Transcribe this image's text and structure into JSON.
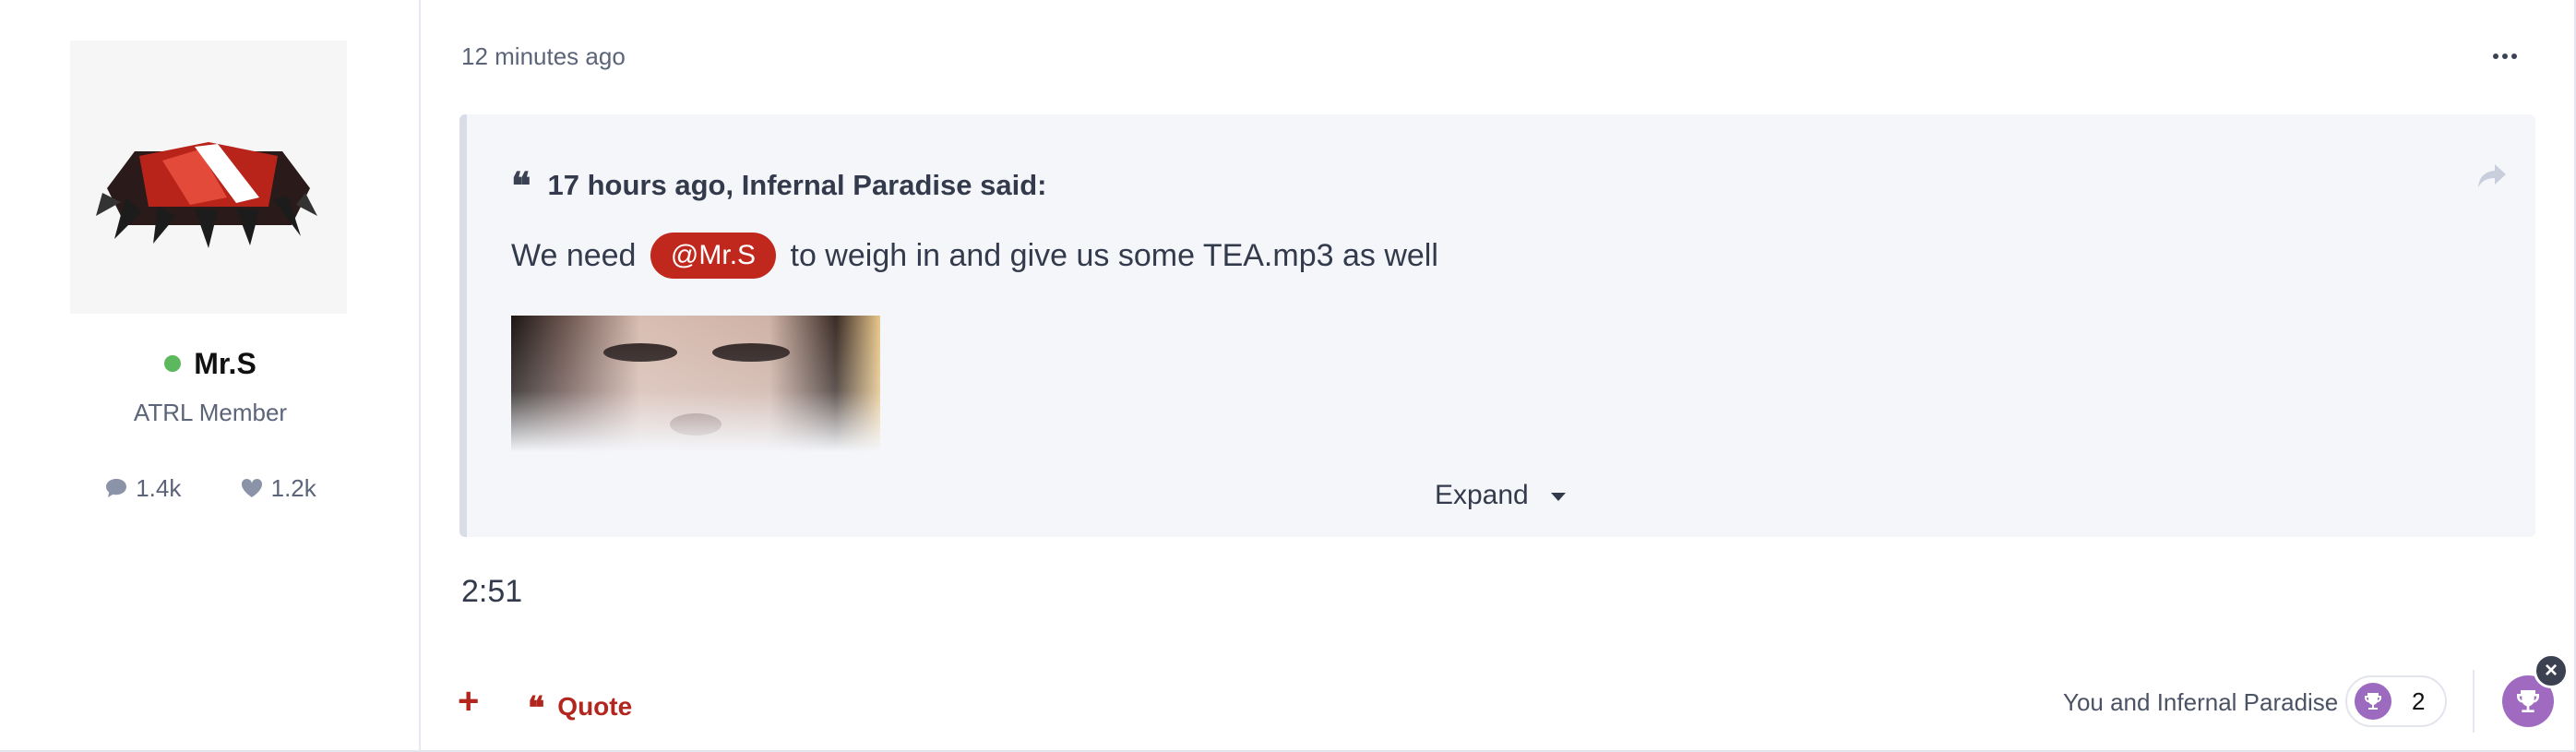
{
  "author": {
    "name": "Mr.S",
    "title": "ATRL Member",
    "posts": "1.4k",
    "likes": "1.2k",
    "status_color": "#5cb85c"
  },
  "post": {
    "time": "12 minutes ago",
    "text": "2:51",
    "quote": {
      "header": "17 hours ago, Infernal Paradise said:",
      "body_before": "We need",
      "mention": "@Mr.S",
      "body_after": "to weigh in and give us some TEA.mp3 as well",
      "expand_label": "Expand"
    }
  },
  "actions": {
    "plus": "+",
    "quote_label": "Quote",
    "reactions_text": "You and Infernal Paradise",
    "reaction_count": "2",
    "close": "×"
  },
  "colors": {
    "accent": "#b3261e",
    "mention_bg": "#c0281d",
    "reaction_purple": "#a06ac0"
  },
  "icons": [
    "chat-icon",
    "heart-icon",
    "quote-icon",
    "share-icon",
    "chevron-down-icon",
    "trophy-icon",
    "more-icon",
    "close-icon"
  ]
}
